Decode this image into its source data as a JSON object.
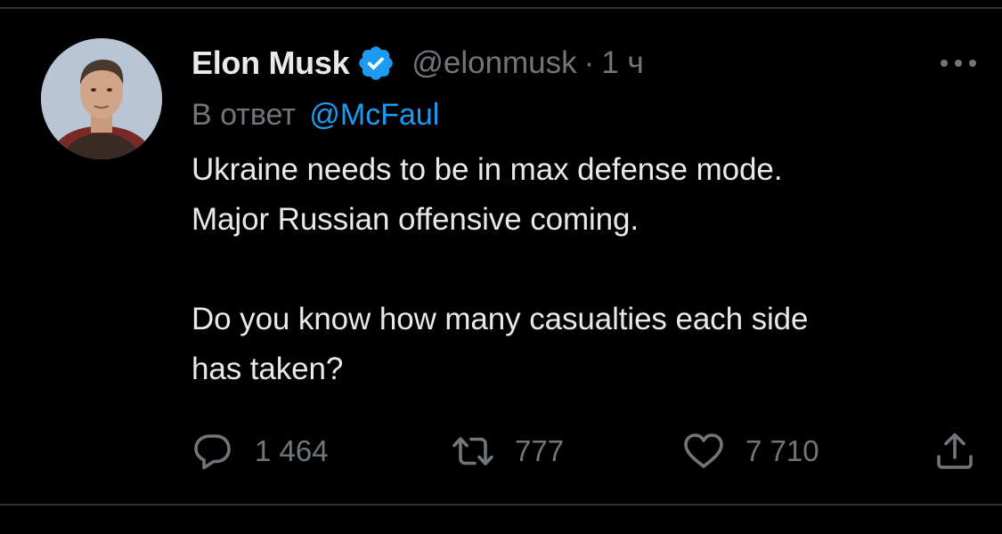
{
  "tweet": {
    "author_name": "Elon Musk",
    "handle": "@elonmusk",
    "separator": "·",
    "time": "1 ч",
    "reply_prefix": "В ответ",
    "reply_to": "@McFaul",
    "text_lines": [
      "Ukraine needs to be in max defense mode.",
      "Major Russian offensive coming.",
      "Do you know how many casualties each side",
      "has taken?"
    ]
  },
  "actions": {
    "reply_count": "1 464",
    "retweet_count": "777",
    "like_count": "7 710"
  },
  "icons": {
    "verified": "verified-badge-icon",
    "more": "more-dots-icon",
    "reply": "reply-bubble-icon",
    "retweet": "retweet-icon",
    "like": "heart-icon",
    "share": "share-upload-icon"
  },
  "colors": {
    "background": "#000000",
    "text": "#e7e9ea",
    "secondary_text": "#71767b",
    "link": "#1d9bf0",
    "verified_badge": "#1d9bf0",
    "divider": "#2f3336"
  }
}
